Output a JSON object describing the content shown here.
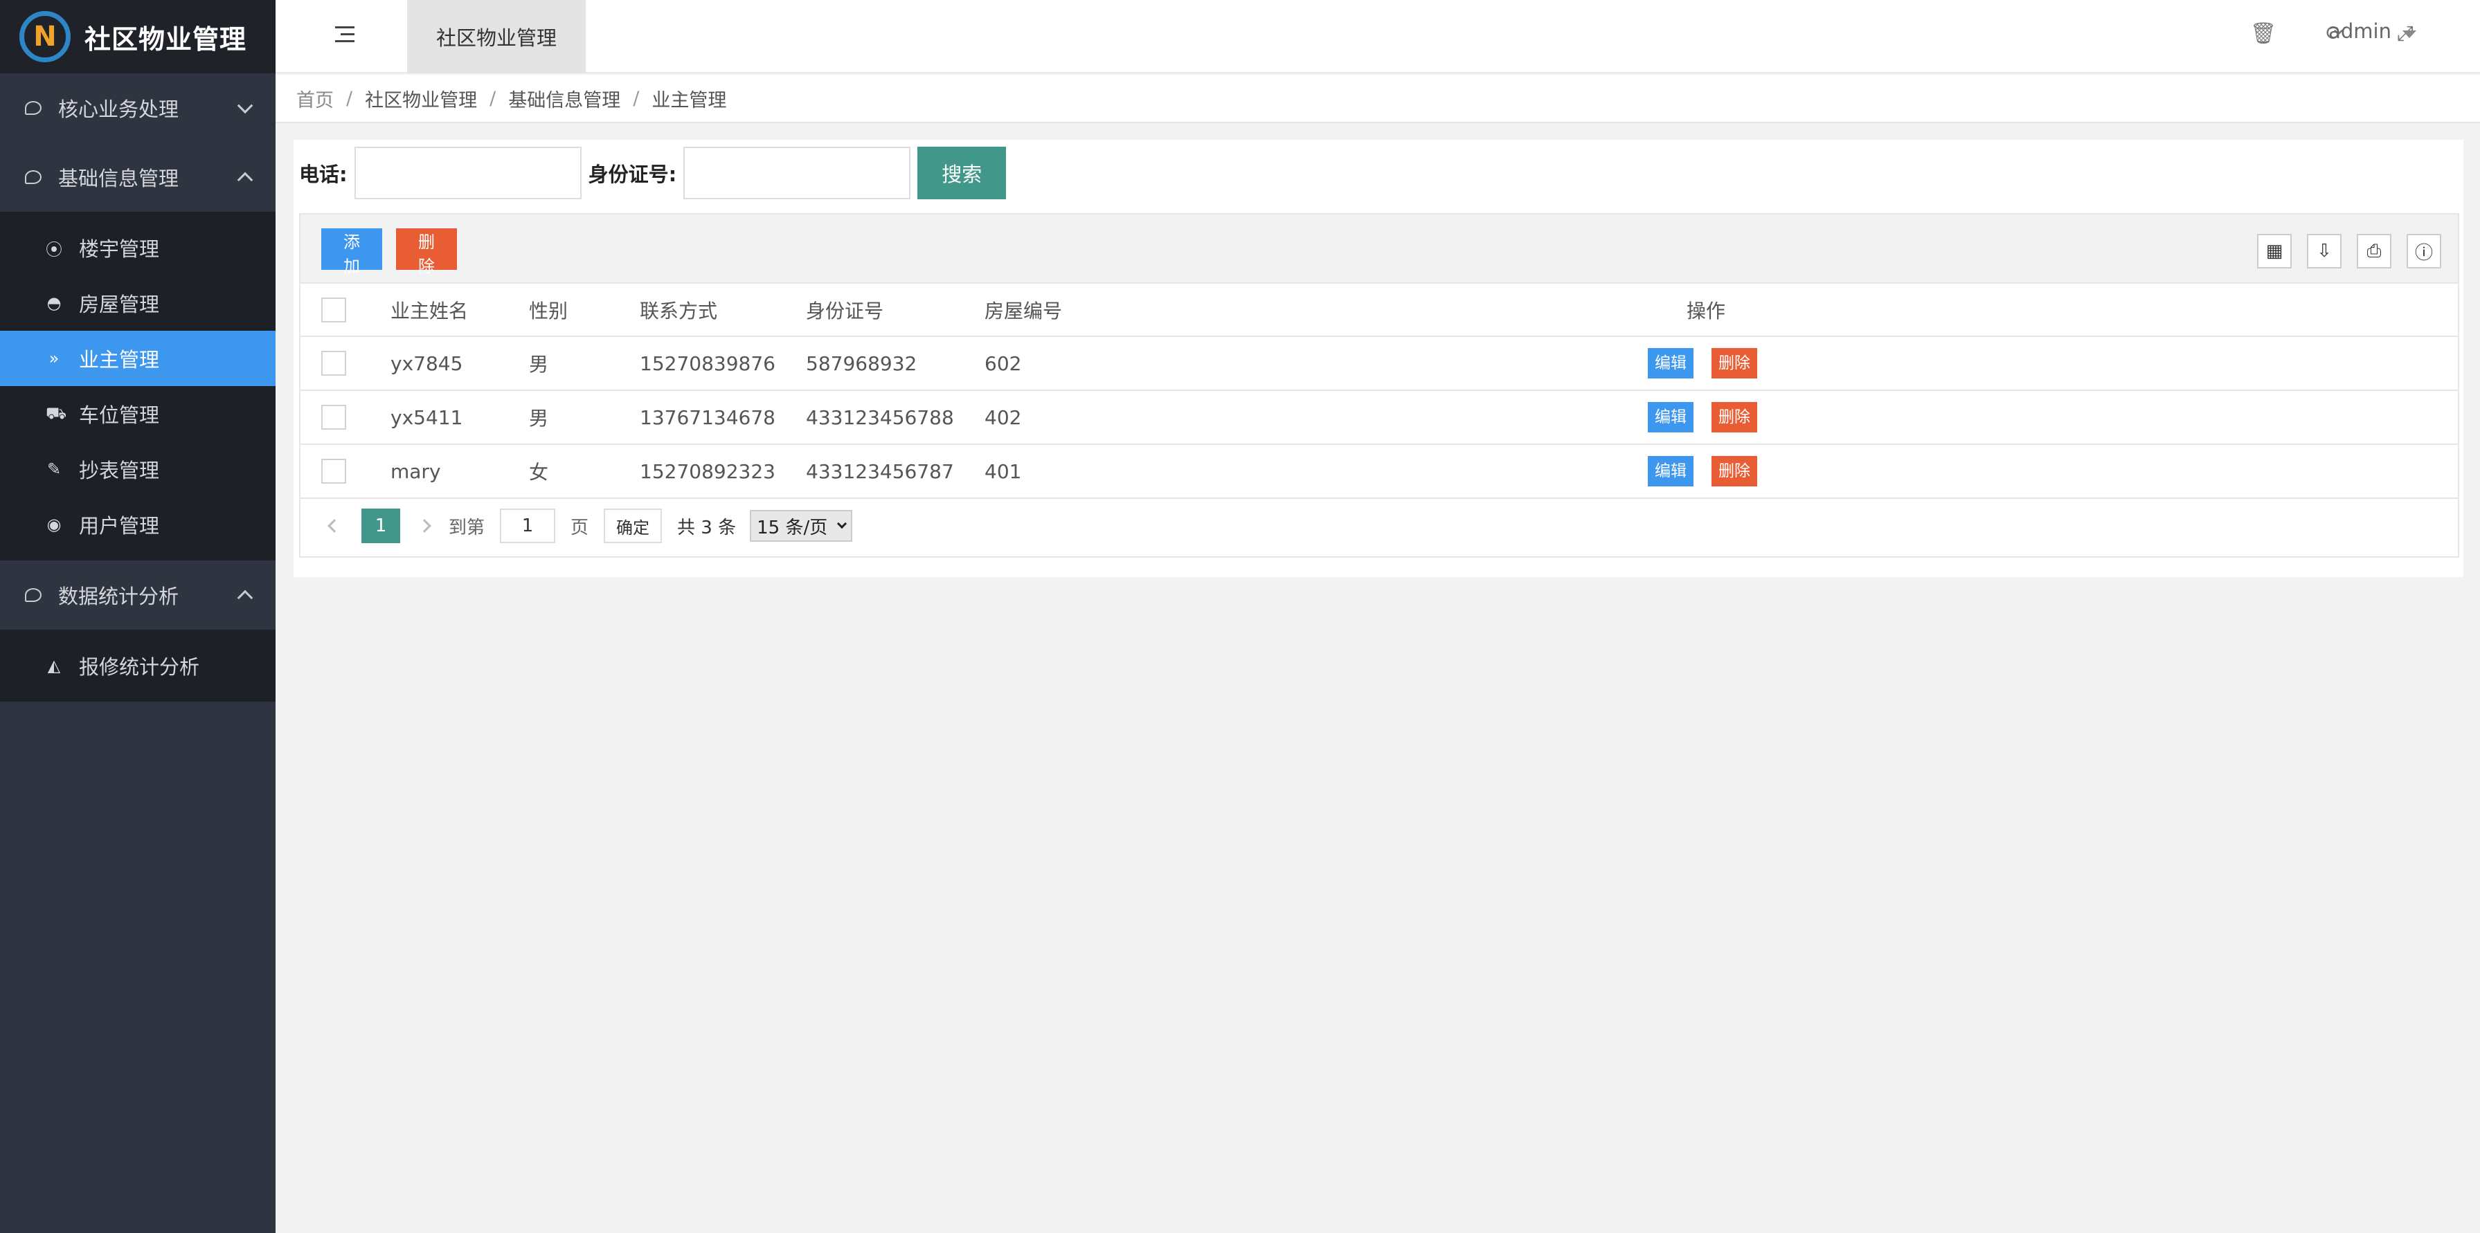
{
  "app": {
    "title": "社区物业管理",
    "logo_letter": "N"
  },
  "colors": {
    "accent": "#3d97ef",
    "primary": "#41988a",
    "danger": "#e95d35",
    "sidebar": "#2f3540"
  },
  "sidebar": {
    "groups": [
      {
        "label": "核心业务处理",
        "icon": "chat-bubble-icon",
        "expanded": false
      },
      {
        "label": "基础信息管理",
        "icon": "chat-bubble-icon",
        "expanded": true,
        "items": [
          {
            "label": "楼宇管理",
            "icon": "target-icon"
          },
          {
            "label": "房屋管理",
            "icon": "home-icon"
          },
          {
            "label": "业主管理",
            "icon": "double-chevron-icon",
            "active": true
          },
          {
            "label": "车位管理",
            "icon": "car-icon"
          },
          {
            "label": "抄表管理",
            "icon": "edit-icon"
          },
          {
            "label": "用户管理",
            "icon": "user-circle-icon"
          }
        ]
      },
      {
        "label": "数据统计分析",
        "icon": "chat-bubble-icon",
        "expanded": true,
        "items": [
          {
            "label": "报修统计分析",
            "icon": "area-chart-icon"
          }
        ]
      }
    ]
  },
  "header": {
    "active_tab": "社区物业管理",
    "user": "admin",
    "icons": [
      "refresh-icon",
      "trash-icon",
      "fullscreen-icon"
    ]
  },
  "breadcrumb": [
    "首页",
    "社区物业管理",
    "基础信息管理",
    "业主管理"
  ],
  "search": {
    "phone_label": "电话:",
    "phone_value": "",
    "idcard_label": "身份证号:",
    "idcard_value": "",
    "button": "搜索"
  },
  "toolbar": {
    "add": "添加",
    "delete": "删除",
    "tools": [
      "columns-icon",
      "export-icon",
      "print-icon",
      "info-icon"
    ]
  },
  "table": {
    "columns": [
      "业主姓名",
      "性别",
      "联系方式",
      "身份证号",
      "房屋编号",
      "操作"
    ],
    "rows": [
      {
        "name": "yx7845",
        "gender": "男",
        "phone": "15270839876",
        "idcard": "587968932",
        "house": "602"
      },
      {
        "name": "yx5411",
        "gender": "男",
        "phone": "13767134678",
        "idcard": "433123456788",
        "house": "402"
      },
      {
        "name": "mary",
        "gender": "女",
        "phone": "15270892323",
        "idcard": "433123456787",
        "house": "401"
      }
    ],
    "edit_label": "编辑",
    "delete_label": "删除"
  },
  "pager": {
    "current": "1",
    "goto_label": "到第",
    "goto_value": "1",
    "page_unit": "页",
    "ok": "确定",
    "total": "共 3 条",
    "page_size": "15 条/页"
  }
}
